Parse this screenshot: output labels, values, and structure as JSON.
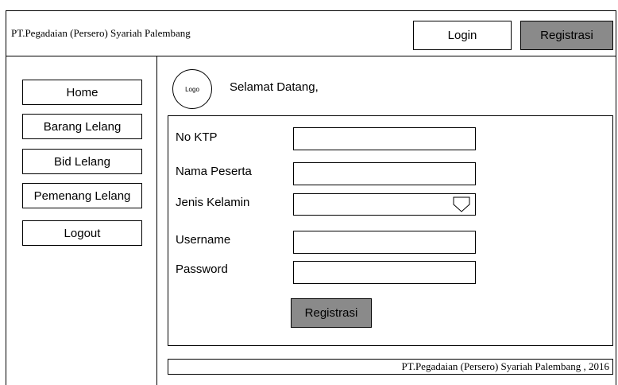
{
  "header": {
    "brand": "PT.Pegadaian (Persero) Syariah Palembang",
    "login_label": "Login",
    "register_label": "Registrasi"
  },
  "sidebar": {
    "items": [
      {
        "label": "Home"
      },
      {
        "label": "Barang Lelang"
      },
      {
        "label": "Bid Lelang"
      },
      {
        "label": "Pemenang Lelang"
      },
      {
        "label": "Logout"
      }
    ]
  },
  "main": {
    "logo_text": "Logo",
    "welcome": "Selamat Datang,",
    "form": {
      "fields": [
        {
          "label": "No KTP",
          "value": ""
        },
        {
          "label": "Nama Peserta",
          "value": ""
        },
        {
          "label": "Jenis Kelamin",
          "value": ""
        },
        {
          "label": "Username",
          "value": ""
        },
        {
          "label": "Password",
          "value": ""
        }
      ],
      "submit_label": "Registrasi"
    }
  },
  "footer": {
    "text": "PT.Pegadaian (Persero) Syariah Palembang , 2016"
  },
  "colors": {
    "button_gray": "#8a8a8a",
    "border": "#000000"
  },
  "icons": {
    "select": "chevron-down-icon"
  }
}
